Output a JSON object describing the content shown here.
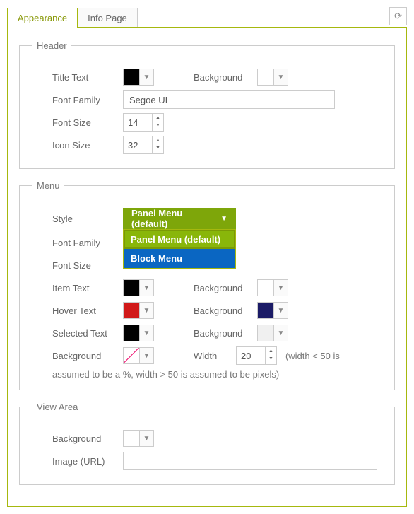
{
  "tabs": {
    "appearance": "Appearance",
    "info": "Info Page"
  },
  "header": {
    "legend": "Header",
    "title_text_label": "Title Text",
    "background_label": "Background",
    "font_family_label": "Font Family",
    "font_family_value": "Segoe UI",
    "font_size_label": "Font Size",
    "font_size_value": "14",
    "icon_size_label": "Icon Size",
    "icon_size_value": "32"
  },
  "menu": {
    "legend": "Menu",
    "style_label": "Style",
    "style_selected": "Panel Menu (default)",
    "style_options": {
      "panel": "Panel Menu (default)",
      "block": "Block Menu"
    },
    "font_family_label": "Font Family",
    "font_size_label": "Font Size",
    "item_text_label": "Item Text",
    "hover_text_label": "Hover Text",
    "selected_text_label": "Selected Text",
    "background_label": "Background",
    "bg_label": "Background",
    "width_label": "Width",
    "width_value": "20",
    "width_hint_a": "(width < 50 is",
    "width_hint_b": "assumed to be a %, width > 50 is assumed to be pixels)"
  },
  "view": {
    "legend": "View Area",
    "background_label": "Background",
    "image_label": "Image (URL)"
  }
}
